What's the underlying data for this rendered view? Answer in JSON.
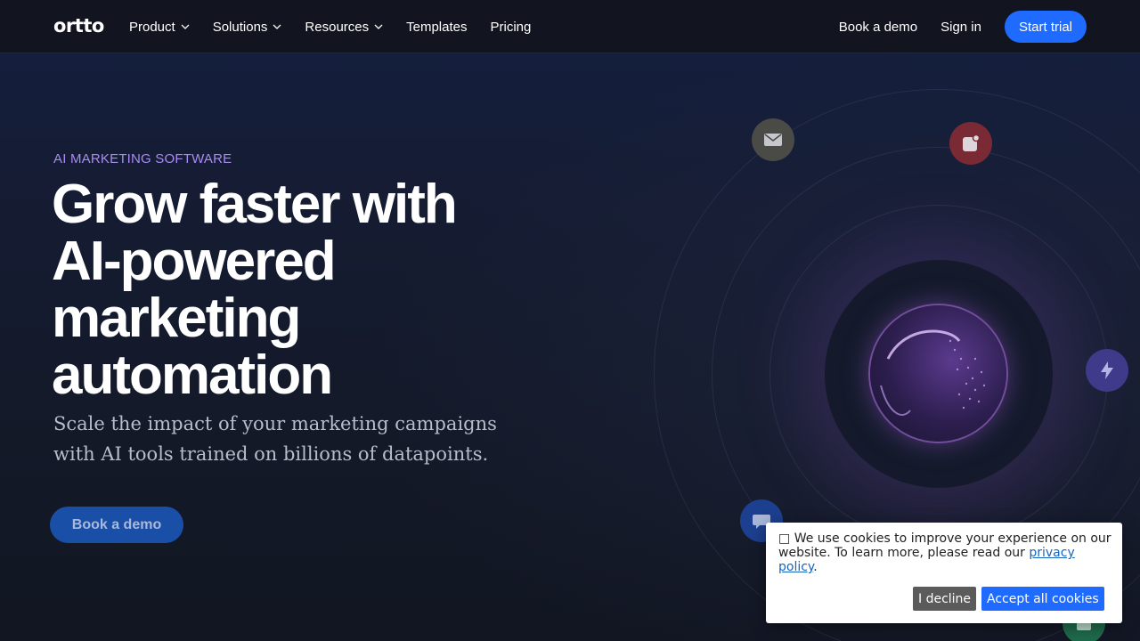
{
  "nav": {
    "logo": "ortto",
    "items": [
      {
        "label": "Product",
        "has_dropdown": true
      },
      {
        "label": "Solutions",
        "has_dropdown": true
      },
      {
        "label": "Resources",
        "has_dropdown": true
      },
      {
        "label": "Templates",
        "has_dropdown": false
      },
      {
        "label": "Pricing",
        "has_dropdown": false
      }
    ],
    "book_demo": "Book a demo",
    "sign_in": "Sign in",
    "start_trial": "Start trial"
  },
  "hero": {
    "eyebrow": "AI MARKETING SOFTWARE",
    "headline_lines": [
      "Grow faster with",
      "AI-powered",
      "marketing",
      "automation"
    ],
    "subtitle_lines": [
      "Scale the impact of your marketing campaigns",
      "with AI tools trained on billions of datapoints."
    ],
    "cta": "Book a demo"
  },
  "orbit_icons": [
    "mail-icon",
    "notification-icon",
    "lightning-icon",
    "chat-icon",
    "gift-icon"
  ],
  "cookie_banner": {
    "icon": "cookie-icon",
    "text_before": "We use cookies to improve your experience on our website. To learn more, please read our ",
    "link": "privacy policy",
    "text_after": ".",
    "decline": "I decline",
    "accept": "Accept all cookies"
  },
  "colors": {
    "accent_blue": "#1f6bff",
    "eyebrow_purple": "#a98bf0",
    "background": "#131826"
  }
}
